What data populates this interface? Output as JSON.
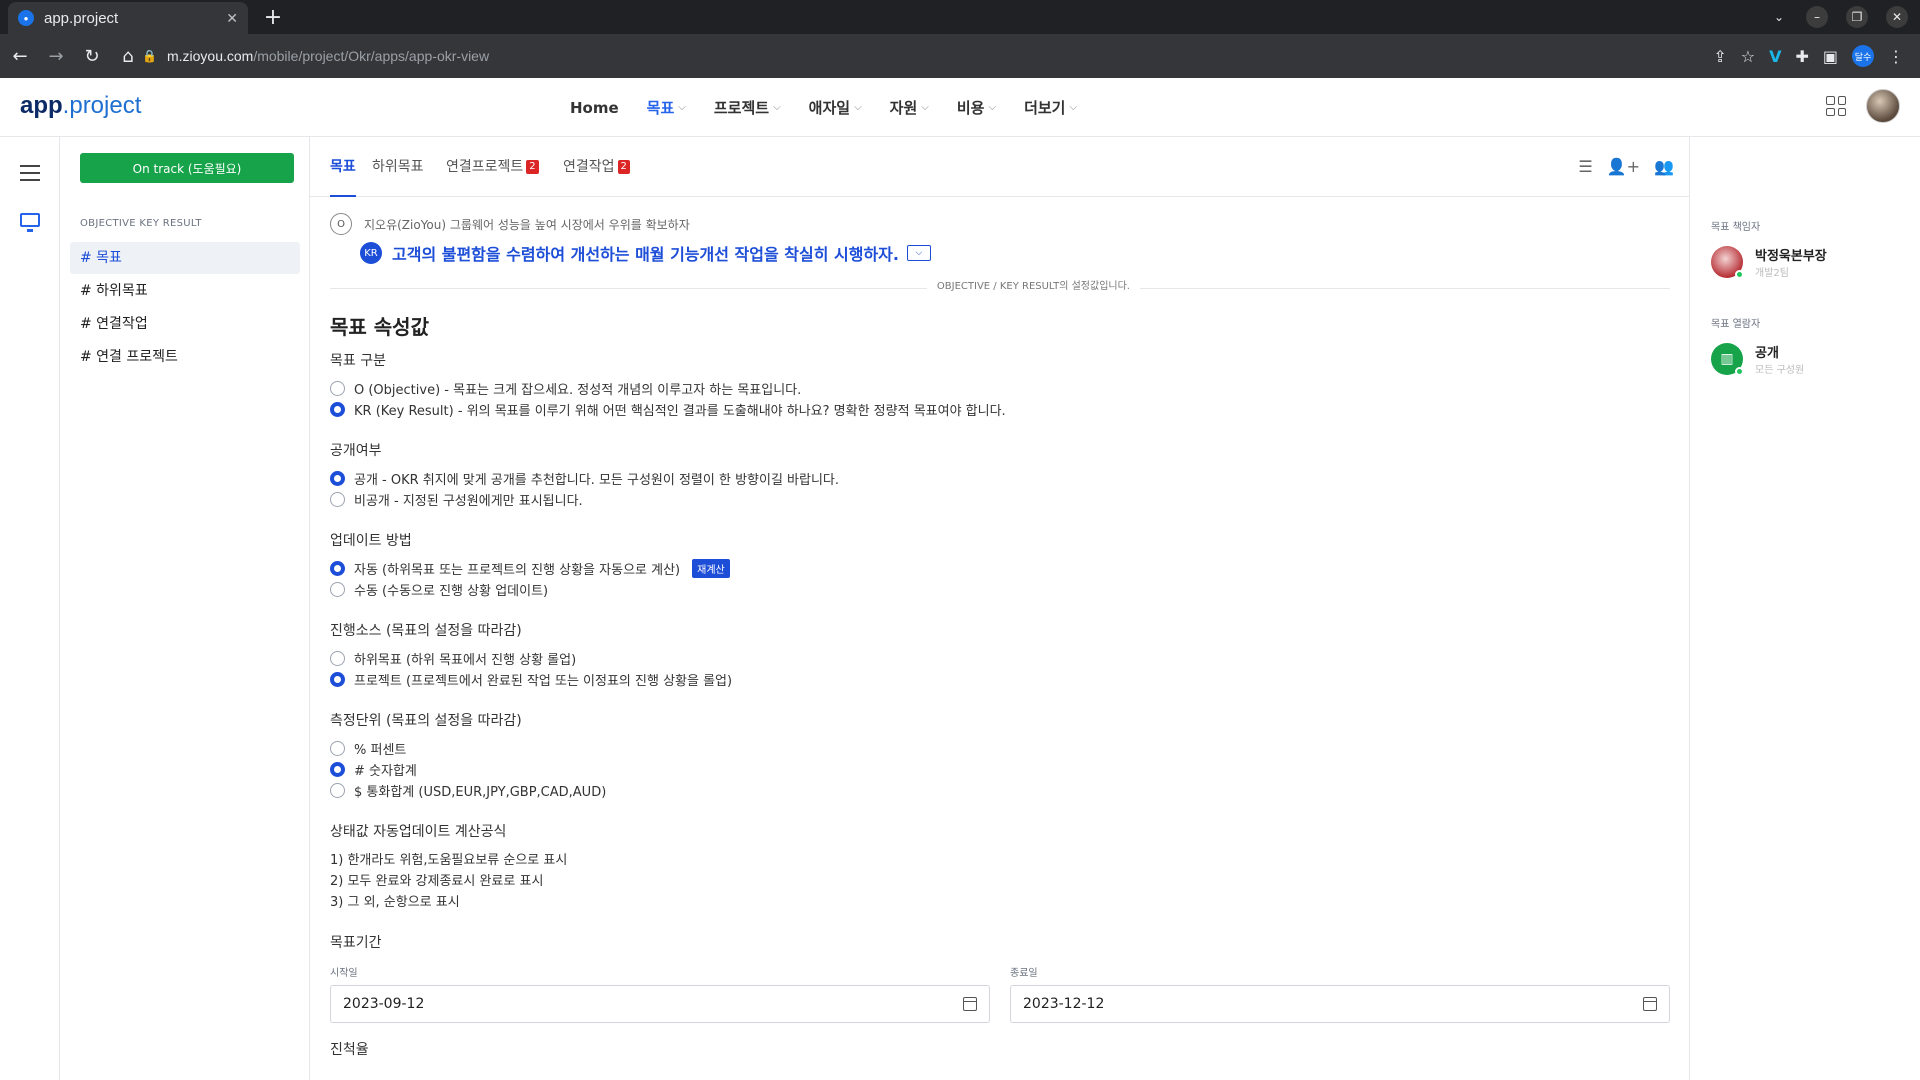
{
  "browser": {
    "tab_title": "app.project",
    "url_host": "m.zioyou.com",
    "url_path": "/mobile/project/Okr/apps/app-okr-view",
    "profile_label": "달수"
  },
  "header": {
    "logo_bold": "app",
    "logo_rest": ".project",
    "nav": [
      {
        "label": "Home"
      },
      {
        "label": "목표"
      },
      {
        "label": "프로젝트"
      },
      {
        "label": "애자일"
      },
      {
        "label": "자원"
      },
      {
        "label": "비용"
      },
      {
        "label": "더보기"
      }
    ]
  },
  "sidebar": {
    "status_button": "On track (도움필요)",
    "heading": "OBJECTIVE KEY RESULT",
    "items": [
      {
        "label": "# 목표"
      },
      {
        "label": "# 하위목표"
      },
      {
        "label": "# 연결작업"
      },
      {
        "label": "# 연결 프로젝트"
      }
    ]
  },
  "tabs": [
    {
      "label": "목표"
    },
    {
      "label": "하위목표"
    },
    {
      "label": "연결프로젝트",
      "count": "2"
    },
    {
      "label": "연결작업",
      "count": "2"
    }
  ],
  "objective": {
    "o_badge": "O",
    "o_text": "지오유(ZioYou) 그룹웨어 성능을 높여 시장에서 우위를 확보하자",
    "kr_badge": "KR",
    "kr_text": "고객의 불편함을 수렴하여 개선하는 매월 기능개선 작업을 착실히 시행하자.",
    "divider_text": "OBJECTIVE / KEY RESULT의 설정값입니다."
  },
  "settings": {
    "title": "목표 속성값",
    "type": {
      "label": "목표 구분",
      "options": [
        "O (Objective) - 목표는 크게 잡으세요. 정성적 개념의 이루고자 하는 목표입니다.",
        "KR (Key Result) - 위의 목표를 이루기 위해 어떤 핵심적인 결과를 도출해내야 하나요? 명확한 정량적 목표여야 합니다."
      ]
    },
    "visibility": {
      "label": "공개여부",
      "options": [
        "공개 - OKR 취지에 맞게 공개를 추천합니다. 모든 구성원이 정렬이 한 방향이길 바랍니다.",
        "비공개 - 지정된 구성원에게만 표시됩니다."
      ]
    },
    "update": {
      "label": "업데이트 방법",
      "options": [
        "자동 (하위목표 또는 프로젝트의 진행 상황을 자동으로 계산)",
        "수동 (수동으로 진행 상황 업데이트)"
      ],
      "recalc": "재계산"
    },
    "source": {
      "label": "진행소스 (목표의 설정을 따라감)",
      "options": [
        "하위목표 (하위 목표에서 진행 상황 롤업)",
        "프로젝트 (프로젝트에서 완료된 작업 또는 이정표의 진행 상황을 롤업)"
      ]
    },
    "unit": {
      "label": "측정단위 (목표의 설정을 따라감)",
      "options": [
        "% 퍼센트",
        "# 숫자합계",
        "$ 통화합계 (USD,EUR,JPY,GBP,CAD,AUD)"
      ]
    },
    "formula": {
      "label": "상태값 자동업데이트 계산공식",
      "rules": [
        "1) 한개라도 위험,도움필요보류 순으로 표시",
        "2) 모두 완료와 강제종료시 완료로 표시",
        "3) 그 외, 순항으로 표시"
      ]
    },
    "period": {
      "label": "목표기간",
      "start_label": "시작일",
      "start": "2023-09-12",
      "end_label": "종료일",
      "end": "2023-12-12"
    },
    "progress_label": "진척율"
  },
  "right_panel": {
    "owner_heading": "목표 책임자",
    "owner_name": "박정욱본부장",
    "owner_dept": "개발2팀",
    "viewer_heading": "목표 열람자",
    "viewer_name": "공개",
    "viewer_sub": "모든 구성원"
  }
}
